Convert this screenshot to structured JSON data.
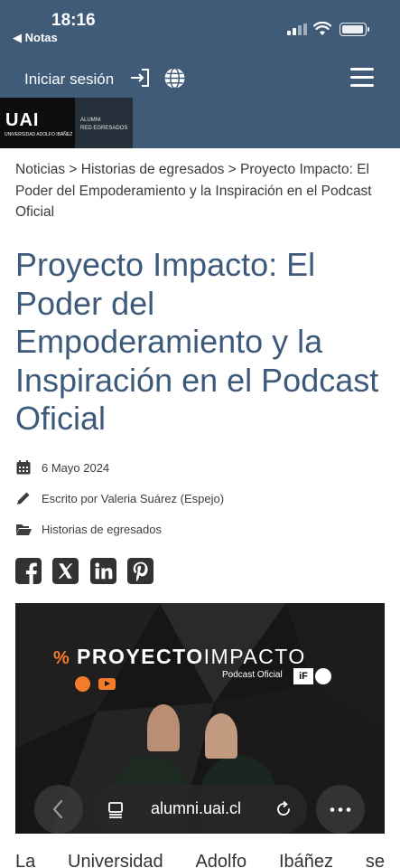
{
  "status_bar": {
    "time": "18:16",
    "back_app": "◀ Notas"
  },
  "header": {
    "login_label": "Iniciar sesión",
    "logo": {
      "mark": "UAI",
      "university": "UNIVERSIDAD ADOLFO IBÁÑEZ",
      "alumni_line1": "ALUMNI",
      "alumni_line2": "RED EGRESADOS"
    }
  },
  "breadcrumb": "Noticias > Historias de egresados > Proyecto Impacto: El Poder del Empoderamiento y la Inspiración en el Podcast Oficial",
  "article": {
    "title": "Proyecto Impacto: El Poder del Empoderamiento y la Inspiración en el Podcast Oficial",
    "date": "6 Mayo 2024",
    "author": "Escrito por Valeria Suárez (Espejo)",
    "category": "Historias de egresados",
    "body_start": [
      "La",
      "Universidad",
      "Adolfo",
      "Ibáñez",
      "se"
    ]
  },
  "social": [
    "facebook-icon",
    "x-icon",
    "linkedin-icon",
    "pinterest-icon"
  ],
  "hero_image": {
    "title_bold": "PROYECTO",
    "title_light": "IMPACTO",
    "subtitle": "Podcast Oficial",
    "brand": "iF"
  },
  "browser": {
    "url": "alumni.uai.cl"
  },
  "colors": {
    "header_bg": "#3f5b77",
    "title": "#3e5a7b",
    "accent": "#f47b2a"
  }
}
